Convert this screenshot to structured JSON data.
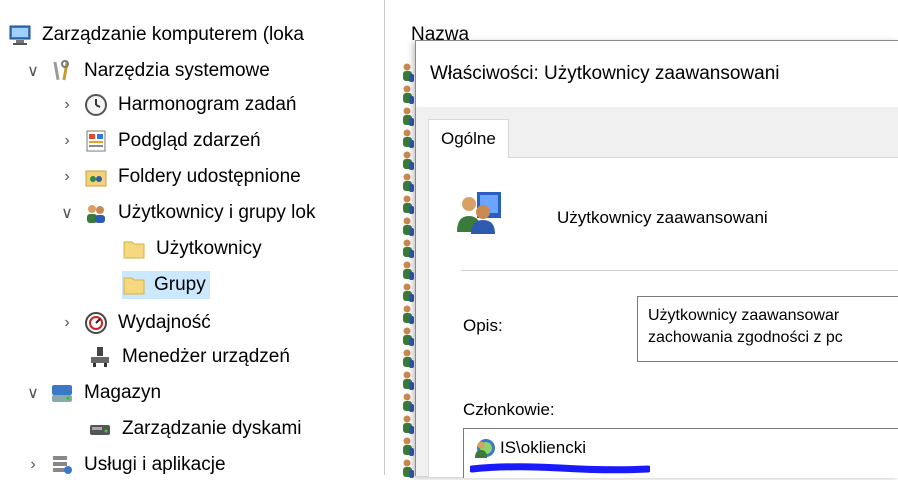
{
  "tree": {
    "items": [
      {
        "label": "Zarządzanie komputerem (loka",
        "icon": "computer-management-icon",
        "chevron": ""
      },
      {
        "label": "Narzędzia systemowe",
        "icon": "tools-icon",
        "chevron": "expanded"
      },
      {
        "label": "Harmonogram zadań",
        "icon": "clock-icon",
        "chevron": "collapsed"
      },
      {
        "label": "Podgląd zdarzeń",
        "icon": "event-viewer-icon",
        "chevron": "collapsed"
      },
      {
        "label": "Foldery udostępnione",
        "icon": "shared-folder-icon",
        "chevron": "collapsed"
      },
      {
        "label": "Użytkownicy i grupy lok",
        "icon": "users-groups-icon",
        "chevron": "expanded"
      },
      {
        "label": "Użytkownicy",
        "icon": "folder-icon",
        "chevron": ""
      },
      {
        "label": "Grupy",
        "icon": "folder-icon",
        "chevron": "",
        "selected": true
      },
      {
        "label": "Wydajność",
        "icon": "performance-icon",
        "chevron": "collapsed"
      },
      {
        "label": "Menedżer urządzeń",
        "icon": "device-manager-icon",
        "chevron": ""
      },
      {
        "label": "Magazyn",
        "icon": "storage-icon",
        "chevron": "expanded"
      },
      {
        "label": "Zarządzanie dyskami",
        "icon": "disk-management-icon",
        "chevron": ""
      },
      {
        "label": "Usługi i aplikacje",
        "icon": "services-icon",
        "chevron": "collapsed"
      }
    ],
    "chevron_expanded": "∨",
    "chevron_collapsed": "›"
  },
  "list": {
    "header": "Nazwa"
  },
  "dialog": {
    "title": "Właściwości: Użytkownicy zaawansowani",
    "tab": "Ogólne",
    "group_name": "Użytkownicy zaawansowani",
    "description_label": "Opis:",
    "description_lines": [
      "Użytkownicy zaawansowar",
      "zachowania zgodności z pc"
    ],
    "members_label": "Członkowie:",
    "members": [
      "IS\\okliencki"
    ]
  },
  "colors": {
    "selection": "#cce8ff",
    "scribble": "#1a1aff"
  }
}
